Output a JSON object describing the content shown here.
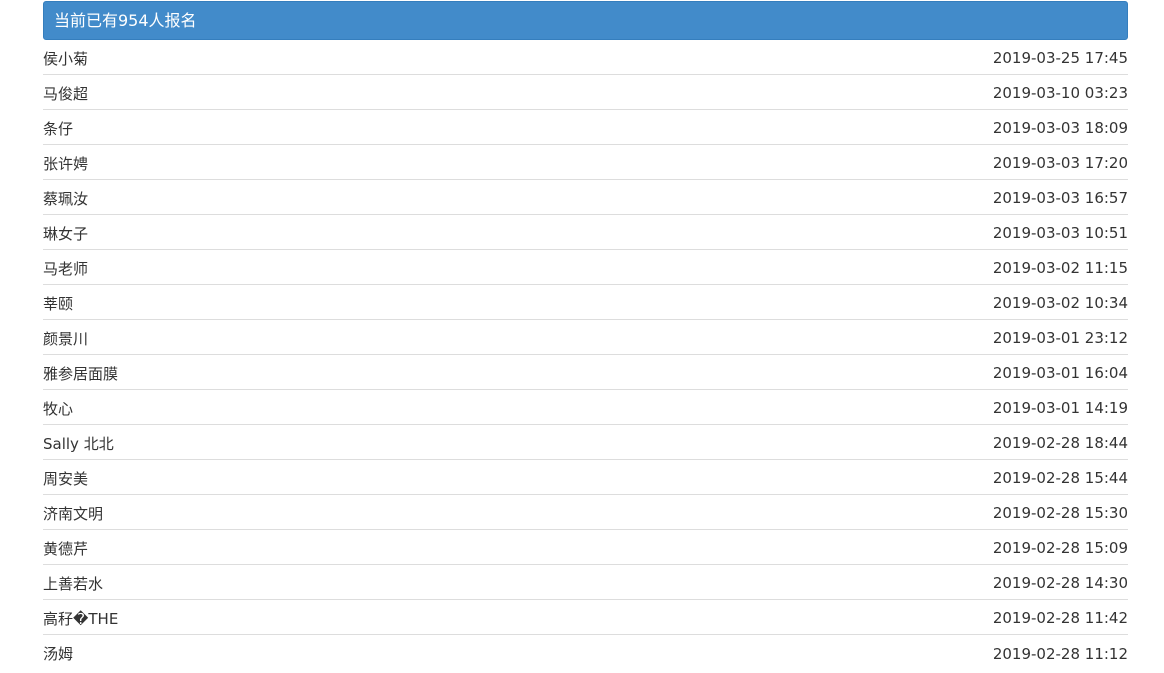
{
  "header": {
    "title": "当前已有954人报名"
  },
  "signups": [
    {
      "name": "侯小菊",
      "time": "2019-03-25 17:45"
    },
    {
      "name": "马俊超",
      "time": "2019-03-10 03:23"
    },
    {
      "name": "条仔",
      "time": "2019-03-03 18:09"
    },
    {
      "name": "张许娉",
      "time": "2019-03-03 17:20"
    },
    {
      "name": "蔡珮汝",
      "time": "2019-03-03 16:57"
    },
    {
      "name": "琳女子",
      "time": "2019-03-03 10:51"
    },
    {
      "name": "马老师",
      "time": "2019-03-02 11:15"
    },
    {
      "name": "莘颐",
      "time": "2019-03-02 10:34"
    },
    {
      "name": "颜景川",
      "time": "2019-03-01 23:12"
    },
    {
      "name": "雅参居面膜",
      "time": "2019-03-01 16:04"
    },
    {
      "name": "牧心",
      "time": "2019-03-01 14:19"
    },
    {
      "name": "Sally 北北",
      "time": "2019-02-28 18:44"
    },
    {
      "name": "周安美",
      "time": "2019-02-28 15:44"
    },
    {
      "name": "济南文明",
      "time": "2019-02-28 15:30"
    },
    {
      "name": "黄德芹",
      "time": "2019-02-28 15:09"
    },
    {
      "name": "上善若水",
      "time": "2019-02-28 14:30"
    },
    {
      "name": "高秄�THE",
      "time": "2019-02-28 11:42"
    },
    {
      "name": "汤姆",
      "time": "2019-02-28 11:12"
    }
  ],
  "colors": {
    "header_bg": "#428bca",
    "header_text": "#ffffff",
    "row_divider": "#dddddd"
  }
}
